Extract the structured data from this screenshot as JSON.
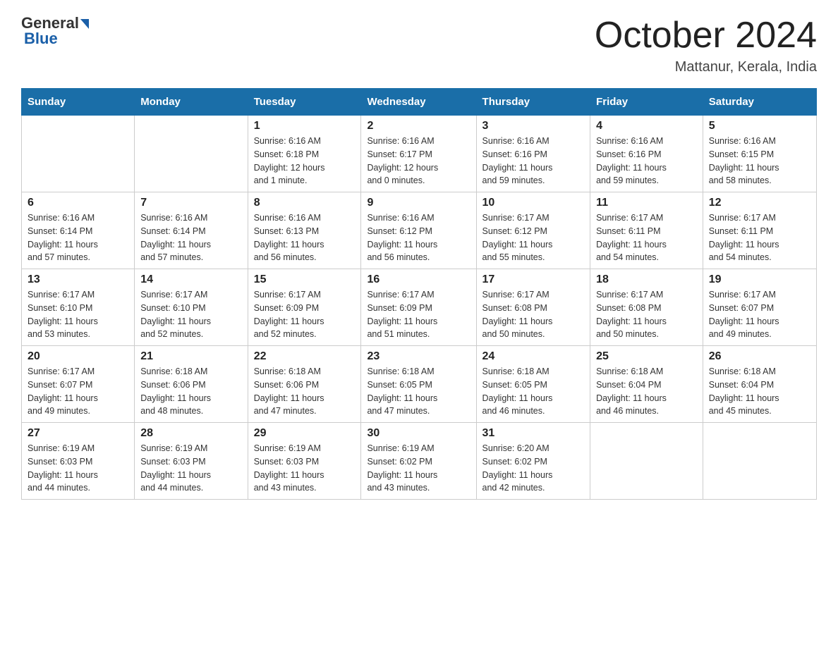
{
  "header": {
    "logo": {
      "general": "General",
      "arrow_color": "#1a5fa8",
      "blue": "Blue"
    },
    "title": "October 2024",
    "location": "Mattanur, Kerala, India"
  },
  "calendar": {
    "days_of_week": [
      "Sunday",
      "Monday",
      "Tuesday",
      "Wednesday",
      "Thursday",
      "Friday",
      "Saturday"
    ],
    "weeks": [
      [
        {
          "day": "",
          "info": ""
        },
        {
          "day": "",
          "info": ""
        },
        {
          "day": "1",
          "info": "Sunrise: 6:16 AM\nSunset: 6:18 PM\nDaylight: 12 hours\nand 1 minute."
        },
        {
          "day": "2",
          "info": "Sunrise: 6:16 AM\nSunset: 6:17 PM\nDaylight: 12 hours\nand 0 minutes."
        },
        {
          "day": "3",
          "info": "Sunrise: 6:16 AM\nSunset: 6:16 PM\nDaylight: 11 hours\nand 59 minutes."
        },
        {
          "day": "4",
          "info": "Sunrise: 6:16 AM\nSunset: 6:16 PM\nDaylight: 11 hours\nand 59 minutes."
        },
        {
          "day": "5",
          "info": "Sunrise: 6:16 AM\nSunset: 6:15 PM\nDaylight: 11 hours\nand 58 minutes."
        }
      ],
      [
        {
          "day": "6",
          "info": "Sunrise: 6:16 AM\nSunset: 6:14 PM\nDaylight: 11 hours\nand 57 minutes."
        },
        {
          "day": "7",
          "info": "Sunrise: 6:16 AM\nSunset: 6:14 PM\nDaylight: 11 hours\nand 57 minutes."
        },
        {
          "day": "8",
          "info": "Sunrise: 6:16 AM\nSunset: 6:13 PM\nDaylight: 11 hours\nand 56 minutes."
        },
        {
          "day": "9",
          "info": "Sunrise: 6:16 AM\nSunset: 6:12 PM\nDaylight: 11 hours\nand 56 minutes."
        },
        {
          "day": "10",
          "info": "Sunrise: 6:17 AM\nSunset: 6:12 PM\nDaylight: 11 hours\nand 55 minutes."
        },
        {
          "day": "11",
          "info": "Sunrise: 6:17 AM\nSunset: 6:11 PM\nDaylight: 11 hours\nand 54 minutes."
        },
        {
          "day": "12",
          "info": "Sunrise: 6:17 AM\nSunset: 6:11 PM\nDaylight: 11 hours\nand 54 minutes."
        }
      ],
      [
        {
          "day": "13",
          "info": "Sunrise: 6:17 AM\nSunset: 6:10 PM\nDaylight: 11 hours\nand 53 minutes."
        },
        {
          "day": "14",
          "info": "Sunrise: 6:17 AM\nSunset: 6:10 PM\nDaylight: 11 hours\nand 52 minutes."
        },
        {
          "day": "15",
          "info": "Sunrise: 6:17 AM\nSunset: 6:09 PM\nDaylight: 11 hours\nand 52 minutes."
        },
        {
          "day": "16",
          "info": "Sunrise: 6:17 AM\nSunset: 6:09 PM\nDaylight: 11 hours\nand 51 minutes."
        },
        {
          "day": "17",
          "info": "Sunrise: 6:17 AM\nSunset: 6:08 PM\nDaylight: 11 hours\nand 50 minutes."
        },
        {
          "day": "18",
          "info": "Sunrise: 6:17 AM\nSunset: 6:08 PM\nDaylight: 11 hours\nand 50 minutes."
        },
        {
          "day": "19",
          "info": "Sunrise: 6:17 AM\nSunset: 6:07 PM\nDaylight: 11 hours\nand 49 minutes."
        }
      ],
      [
        {
          "day": "20",
          "info": "Sunrise: 6:17 AM\nSunset: 6:07 PM\nDaylight: 11 hours\nand 49 minutes."
        },
        {
          "day": "21",
          "info": "Sunrise: 6:18 AM\nSunset: 6:06 PM\nDaylight: 11 hours\nand 48 minutes."
        },
        {
          "day": "22",
          "info": "Sunrise: 6:18 AM\nSunset: 6:06 PM\nDaylight: 11 hours\nand 47 minutes."
        },
        {
          "day": "23",
          "info": "Sunrise: 6:18 AM\nSunset: 6:05 PM\nDaylight: 11 hours\nand 47 minutes."
        },
        {
          "day": "24",
          "info": "Sunrise: 6:18 AM\nSunset: 6:05 PM\nDaylight: 11 hours\nand 46 minutes."
        },
        {
          "day": "25",
          "info": "Sunrise: 6:18 AM\nSunset: 6:04 PM\nDaylight: 11 hours\nand 46 minutes."
        },
        {
          "day": "26",
          "info": "Sunrise: 6:18 AM\nSunset: 6:04 PM\nDaylight: 11 hours\nand 45 minutes."
        }
      ],
      [
        {
          "day": "27",
          "info": "Sunrise: 6:19 AM\nSunset: 6:03 PM\nDaylight: 11 hours\nand 44 minutes."
        },
        {
          "day": "28",
          "info": "Sunrise: 6:19 AM\nSunset: 6:03 PM\nDaylight: 11 hours\nand 44 minutes."
        },
        {
          "day": "29",
          "info": "Sunrise: 6:19 AM\nSunset: 6:03 PM\nDaylight: 11 hours\nand 43 minutes."
        },
        {
          "day": "30",
          "info": "Sunrise: 6:19 AM\nSunset: 6:02 PM\nDaylight: 11 hours\nand 43 minutes."
        },
        {
          "day": "31",
          "info": "Sunrise: 6:20 AM\nSunset: 6:02 PM\nDaylight: 11 hours\nand 42 minutes."
        },
        {
          "day": "",
          "info": ""
        },
        {
          "day": "",
          "info": ""
        }
      ]
    ]
  }
}
